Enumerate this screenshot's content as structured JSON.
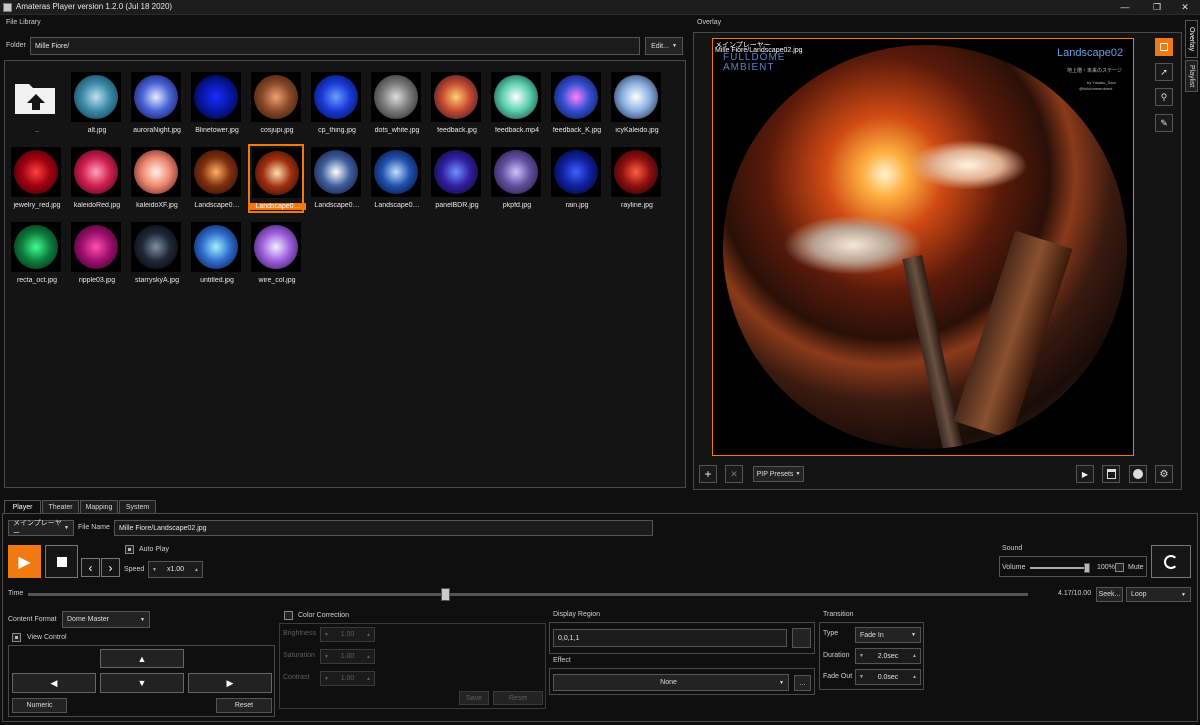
{
  "window": {
    "title": "Amateras Player version 1.2.0 (Jul 18 2020)"
  },
  "file_library": {
    "title": "File Library",
    "folder_label": "Folder",
    "folder_value": "Mille Fiore/",
    "edit_label": "Edit...",
    "items": [
      {
        "label": "..",
        "type": "folder"
      },
      {
        "label": "alt.jpg",
        "colors": [
          "#bfe3ee",
          "#3d8aa8",
          "#0d2d3c"
        ]
      },
      {
        "label": "auroraNight.jpg",
        "colors": [
          "#e4ecff",
          "#4a63d8",
          "#0a0a3a"
        ]
      },
      {
        "label": "Blinetower.jpg",
        "colors": [
          "#1a2cff",
          "#0818a8",
          "#000010"
        ]
      },
      {
        "label": "cosjupi.jpg",
        "colors": [
          "#f0a070",
          "#8a4a2a",
          "#2a1408"
        ]
      },
      {
        "label": "cp_thing.jpg",
        "colors": [
          "#6aa0ff",
          "#1a3ad8",
          "#020a40"
        ]
      },
      {
        "label": "dots_white.jpg",
        "colors": [
          "#dddddd",
          "#7a7a7a",
          "#1a1a1a"
        ]
      },
      {
        "label": "feedback.jpg",
        "colors": [
          "#ffd070",
          "#c84a30",
          "#181030"
        ]
      },
      {
        "label": "feedback.mp4",
        "colors": [
          "#ffffff",
          "#5ad0b0",
          "#182830"
        ]
      },
      {
        "label": "feedback_K.jpg",
        "colors": [
          "#ff80ff",
          "#3050d0",
          "#100830"
        ]
      },
      {
        "label": "icyKaleido.jpg",
        "colors": [
          "#ffffff",
          "#8ab0e0",
          "#101830"
        ]
      },
      {
        "label": "jewelry_red.jpg",
        "colors": [
          "#ff4040",
          "#a00010",
          "#200004"
        ]
      },
      {
        "label": "kaleidoRed.jpg",
        "colors": [
          "#ffa0c0",
          "#d02050",
          "#300010"
        ]
      },
      {
        "label": "kaleidoXF.jpg",
        "colors": [
          "#fff0e8",
          "#f08870",
          "#401010"
        ]
      },
      {
        "label": "Landscape0…",
        "colors": [
          "#ffb060",
          "#803010",
          "#1a0804"
        ]
      },
      {
        "label": "Landscape0…",
        "colors": [
          "#ffe0b0",
          "#a03010",
          "#200800"
        ],
        "selected": true
      },
      {
        "label": "Landscape0…",
        "colors": [
          "#ffffff",
          "#4060a0",
          "#0a0a20"
        ]
      },
      {
        "label": "Landscape0…",
        "colors": [
          "#c0e0ff",
          "#2050b0",
          "#000818"
        ]
      },
      {
        "label": "panelBDR.jpg",
        "colors": [
          "#7090ff",
          "#3020a0",
          "#080418"
        ]
      },
      {
        "label": "pkpfd.jpg",
        "colors": [
          "#d0c0ff",
          "#6050a0",
          "#181030"
        ]
      },
      {
        "label": "rain.jpg",
        "colors": [
          "#4060ff",
          "#1020a0",
          "#000010"
        ]
      },
      {
        "label": "rayline.jpg",
        "colors": [
          "#ff6040",
          "#901010",
          "#100000"
        ]
      },
      {
        "label": "recta_oct.jpg",
        "colors": [
          "#40ff90",
          "#108040",
          "#001808"
        ]
      },
      {
        "label": "ripple03.jpg",
        "colors": [
          "#ff50b0",
          "#a01070",
          "#200018"
        ]
      },
      {
        "label": "starryskyA.jpg",
        "colors": [
          "#8090a0",
          "#202838",
          "#000000"
        ]
      },
      {
        "label": "untitled.jpg",
        "colors": [
          "#a0f0ff",
          "#3070d0",
          "#080830"
        ]
      },
      {
        "label": "wire_col.jpg",
        "colors": [
          "#f0f0ff",
          "#a060e0",
          "#201040"
        ]
      }
    ]
  },
  "overlay": {
    "title": "Overlay",
    "osd_line1": "メインプレーヤー",
    "osd_line2": "Mille Fiore/Landscape02.jpg",
    "brand_line1": "FULLDOME",
    "brand_line2": "AMBIENT",
    "image_title": "Landscape02",
    "image_subtitle": "地上階・未来のステージ",
    "image_credit1": "by Yusaku_Sato",
    "image_credit2": "@fulldomeambient",
    "pip_presets_label": "PIP Presets"
  },
  "side_tabs": [
    "Overlay",
    "Playlist"
  ],
  "tabs": [
    "Player",
    "Theater",
    "Mapping",
    "System"
  ],
  "player": {
    "source_value": "メインプレーヤー",
    "file_name_label": "File Name",
    "file_name_value": "Mille Fiore/Landscape02.jpg",
    "auto_play_label": "Auto Play",
    "speed_label": "Speed",
    "speed_value": "x1.00",
    "sound_label": "Sound",
    "volume_label": "Volume",
    "volume_value": "100%",
    "volume_level": 1.0,
    "mute_label": "Mute",
    "time_label": "Time",
    "time_value": "4.17/10.00",
    "time_position": 0.417,
    "seek_label": "Seek...",
    "loop_value": "Loop",
    "content_format_label": "Content Format",
    "content_format_value": "Dome Master",
    "view_control_label": "View Control",
    "numeric_label": "Numeric",
    "reset_label": "Reset"
  },
  "color_correction": {
    "label": "Color Correction",
    "brightness_label": "Brightness",
    "brightness_value": "1.00",
    "saturation_label": "Saturation",
    "saturation_value": "1.00",
    "contrast_label": "Contrast",
    "contrast_value": "1.00",
    "save_label": "Save",
    "reset_label": "Reset"
  },
  "display_region": {
    "label": "Display Region",
    "value": "0,0,1,1"
  },
  "effect": {
    "label": "Effect",
    "value": "None",
    "more_label": "..."
  },
  "transition": {
    "label": "Transition",
    "type_label": "Type",
    "type_value": "Fade In",
    "duration_label": "Duration",
    "duration_value": "2.0sec",
    "fade_out_label": "Fade Out",
    "fade_out_value": "0.0sec"
  },
  "colors": {
    "accent": "#f07a10",
    "background": "#0f0f0f",
    "panel_border": "#4a4a4a"
  }
}
